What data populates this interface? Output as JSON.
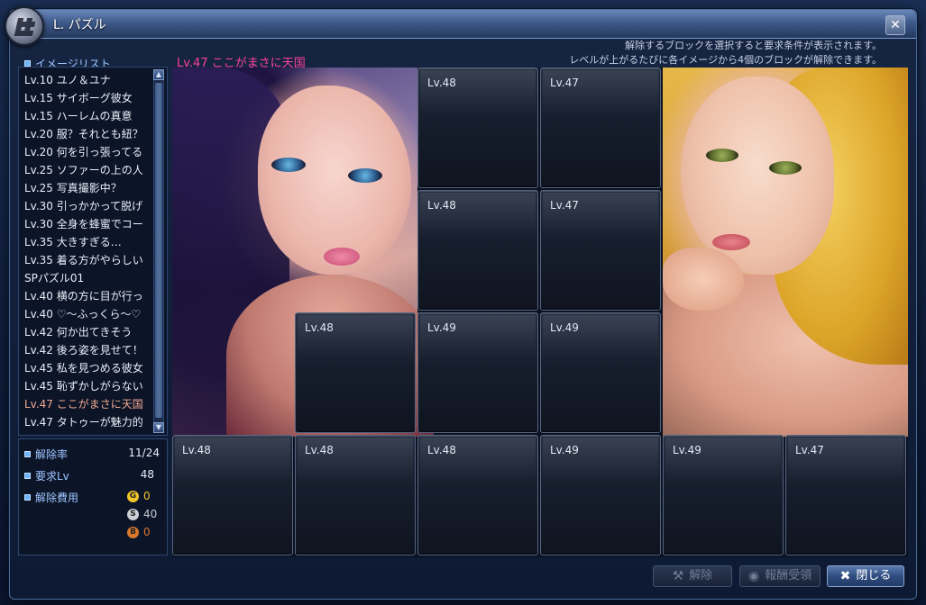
{
  "window": {
    "title": "L. パズル",
    "hint_line1": "解除するブロックを選択すると要求条件が表示されます。",
    "hint_line2": "レベルが上がるたびに各イメージから4個のブロックが解除できます。"
  },
  "image_list": {
    "header": "イメージリスト",
    "items": [
      {
        "label": "Lv.10 ユノ＆ユナ"
      },
      {
        "label": "Lv.15 サイボーグ彼女"
      },
      {
        "label": "Lv.15 ハーレムの真意"
      },
      {
        "label": "Lv.20 服？それとも紐？"
      },
      {
        "label": "Lv.20 何を引っ張ってる"
      },
      {
        "label": "Lv.25 ソファーの上の人"
      },
      {
        "label": "Lv.25 写真撮影中？"
      },
      {
        "label": "Lv.30 引っかかって脱げ"
      },
      {
        "label": "Lv.30 全身を蜂蜜でコー"
      },
      {
        "label": "Lv.35 大きすぎる…"
      },
      {
        "label": "Lv.35 着る方がやらしい"
      },
      {
        "label": "SPパズル01"
      },
      {
        "label": "Lv.40 横の方に目が行っ"
      },
      {
        "label": "Lv.40 ♡～ふっくら～♡"
      },
      {
        "label": "Lv.42 何か出てきそう"
      },
      {
        "label": "Lv.42 後ろ姿を見せて！"
      },
      {
        "label": "Lv.45 私を見つめる彼女"
      },
      {
        "label": "Lv.45 恥ずかしがらない"
      },
      {
        "label": "Lv.47 ここがまさに天国"
      },
      {
        "label": "Lv.47 タトゥーが魅力的"
      }
    ],
    "selected_index": 18
  },
  "stats": {
    "release_rate_label": "解除率",
    "release_rate_value": "11/24",
    "required_lv_label": "要求Lv",
    "required_lv_value": "48",
    "cost_label": "解除費用",
    "gold": {
      "symbol": "G",
      "value": "0",
      "color": "#f2c62a"
    },
    "silver": {
      "symbol": "S",
      "value": "40",
      "color": "#c9cdd4"
    },
    "bronze": {
      "symbol": "B",
      "value": "0",
      "color": "#d8792e"
    }
  },
  "puzzle": {
    "title": "Lv.47 ここがまさに天国",
    "tiles": [
      {
        "label": "Lv.48"
      },
      {
        "label": "Lv.47"
      },
      {
        "label": "Lv.48"
      },
      {
        "label": "Lv.47"
      },
      {
        "label": "Lv.48"
      },
      {
        "label": "Lv.49"
      },
      {
        "label": "Lv.49"
      },
      {
        "label": "Lv.48"
      },
      {
        "label": "Lv.48"
      },
      {
        "label": "Lv.48"
      },
      {
        "label": "Lv.49"
      },
      {
        "label": "Lv.49"
      },
      {
        "label": "Lv.47"
      }
    ]
  },
  "buttons": {
    "unlock": "解除",
    "receive_reward": "報酬受領",
    "close": "閉じる"
  },
  "icons": {
    "app_logo": "puzzle-grid-icon",
    "close": "close-icon",
    "unlock": "hammer-icon",
    "reward": "circle-icon",
    "close_button": "x-icon"
  }
}
